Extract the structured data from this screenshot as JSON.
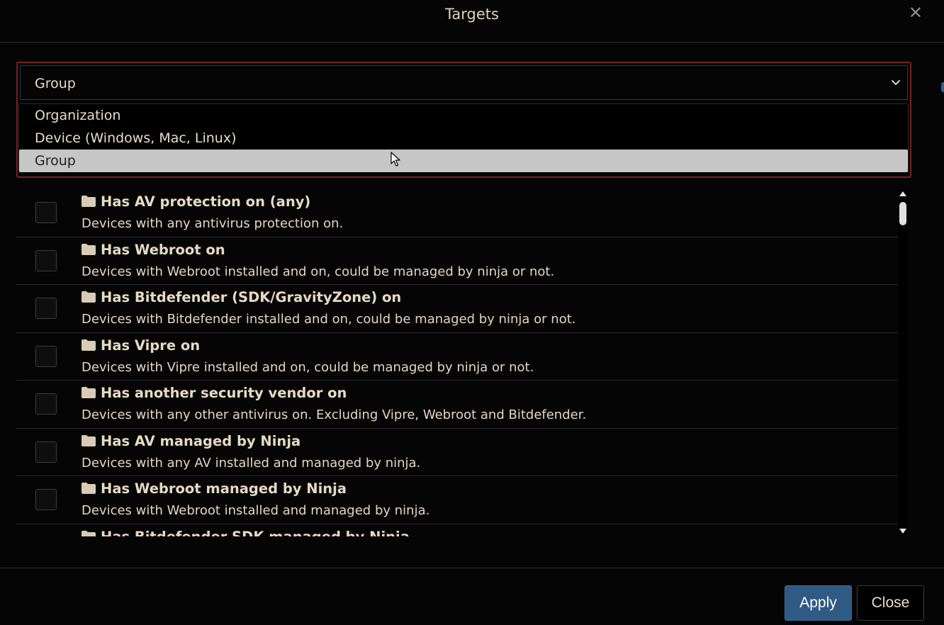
{
  "modal": {
    "title": "Targets",
    "close_icon": "close-icon"
  },
  "target_select": {
    "value": "Group",
    "options": [
      {
        "label": "Organization"
      },
      {
        "label": "Device (Windows, Mac, Linux)"
      },
      {
        "label": "Group"
      }
    ],
    "highlighted_option": "Group"
  },
  "groups": [
    {
      "title": "Has AV protection on (any)",
      "description": "Devices with any antivirus protection on.",
      "icon": "folder-icon"
    },
    {
      "title": "Has Webroot on",
      "description": "Devices with Webroot installed and on, could be managed by ninja or not.",
      "icon": "folder-icon"
    },
    {
      "title": "Has Bitdefender (SDK/GravityZone) on",
      "description": "Devices with Bitdefender installed and on, could be managed by ninja or not.",
      "icon": "folder-icon"
    },
    {
      "title": "Has Vipre on",
      "description": "Devices with Vipre installed and on, could be managed by ninja or not.",
      "icon": "folder-icon"
    },
    {
      "title": "Has another security vendor on",
      "description": "Devices with any other antivirus on. Excluding Vipre, Webroot and Bitdefender.",
      "icon": "folder-icon"
    },
    {
      "title": "Has AV managed by Ninja",
      "description": "Devices with any AV installed and managed by ninja.",
      "icon": "folder-icon"
    },
    {
      "title": "Has Webroot managed by Ninja",
      "description": "Devices with Webroot installed and managed by ninja.",
      "icon": "folder-icon"
    },
    {
      "title": "Has Bitdefender SDK managed by Ninja",
      "description": "",
      "icon": "folder-icon"
    }
  ],
  "footer": {
    "apply_label": "Apply",
    "close_label": "Close"
  },
  "colors": {
    "background": "#050505",
    "text": "#e8dcc8",
    "apply_button": "#2f5a84",
    "focus_border": "#7a1f1f",
    "selected_option": "#c6c6c6"
  }
}
